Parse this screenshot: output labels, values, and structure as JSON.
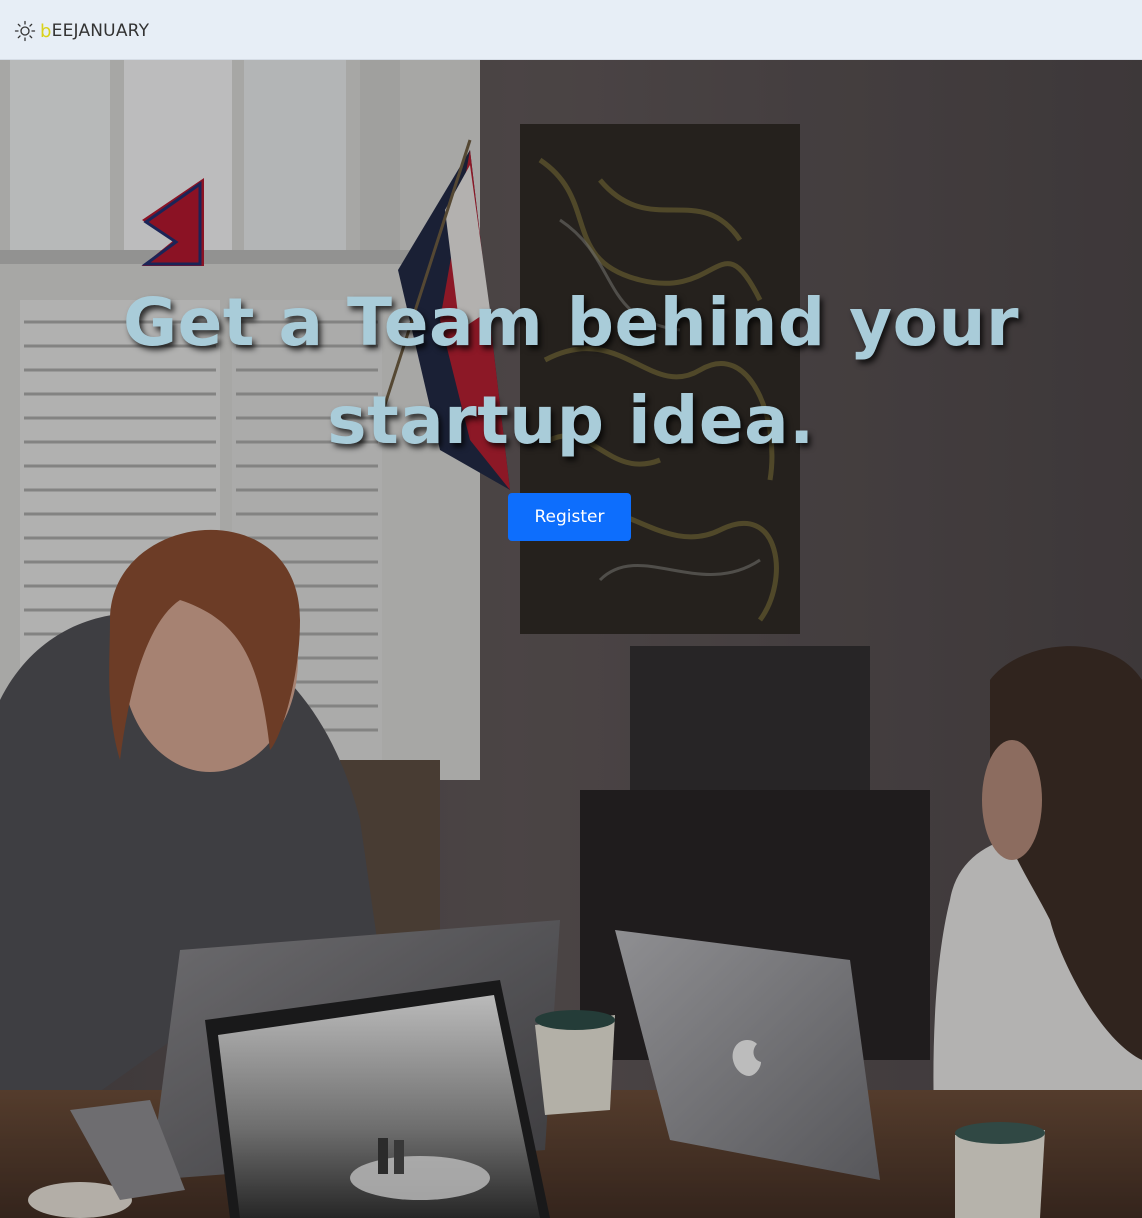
{
  "navbar": {
    "brand_first_letter": "b",
    "brand_rest": "EEJANUARY",
    "brand_icon": "sun-icon"
  },
  "hero": {
    "headline": "Get a Team behind your startup idea.",
    "register_label": "Register",
    "background_description_icon": "office-photo"
  },
  "colors": {
    "navbar_bg": "#e7eef6",
    "brand_accent": "#d9d21a",
    "headline": "#a9ccd9",
    "button": "#0d6efd"
  }
}
